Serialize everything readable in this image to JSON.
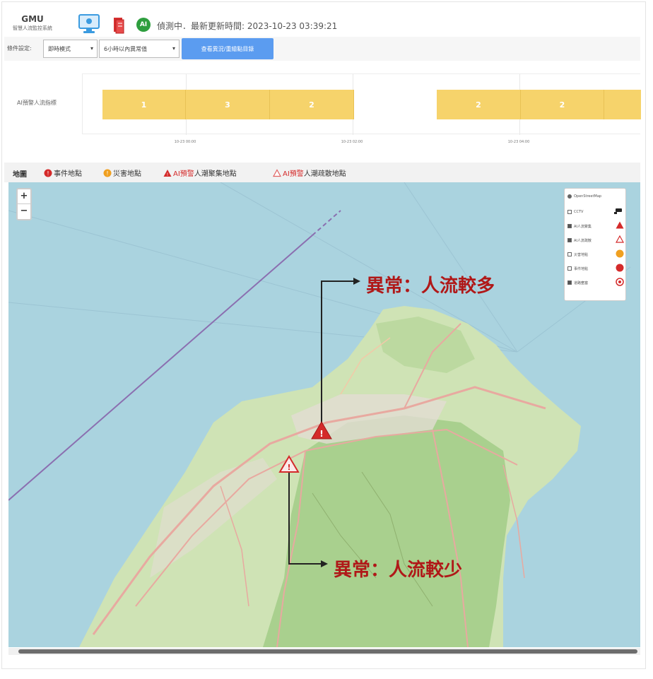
{
  "header": {
    "logo_title": "GMU",
    "logo_subtitle": "智慧人流監控系統",
    "ai_badge": "AI",
    "status_text": "偵測中．最新更新時間: 2023-10-23 03:39:21"
  },
  "toolbar": {
    "label": "條件設定:",
    "select_mode": "即時模式",
    "select_range": "6小時以內異常值",
    "button": "查看異況/重繪點目錄"
  },
  "timeline": {
    "label": "AI預警人流指標",
    "bars": [
      {
        "value": "1"
      },
      {
        "value": "3"
      },
      {
        "value": "2"
      },
      {
        "value": "2"
      },
      {
        "value": "2"
      }
    ],
    "ticks": [
      "10-23 00:00",
      "10-23 02:00",
      "10-23 04:00"
    ]
  },
  "map_legend": {
    "title": "地圖",
    "event_label": "事件地點",
    "disaster_label": "災害地點",
    "ai_label": "AI預警",
    "crowd_more_label": "人潮聚集地點",
    "crowd_less_label": "人潮疏散地點"
  },
  "map": {
    "zoom_in": "+",
    "zoom_out": "−",
    "layers": [
      {
        "label": "OpenStreetMap",
        "type": "radio"
      },
      {
        "label": "CCTV",
        "type": "checkbox",
        "checked": false
      },
      {
        "label": "AI人流聚集",
        "type": "checkbox",
        "checked": true
      },
      {
        "label": "AI人流疏散",
        "type": "checkbox",
        "checked": true
      },
      {
        "label": "災害地點",
        "type": "checkbox",
        "checked": false
      },
      {
        "label": "事件地點",
        "type": "checkbox",
        "checked": false
      },
      {
        "label": "道路壅塞",
        "type": "checkbox",
        "checked": true
      }
    ],
    "annotation_more": "異常：人流較多",
    "annotation_less": "異常：人流較少",
    "colors": {
      "sea": "#aad3df",
      "land": "#cfe3b5",
      "forest": "#a9d08e",
      "road": "#e8a9a0",
      "alert_red": "#d42a2a",
      "annotation": "#b01818"
    }
  }
}
